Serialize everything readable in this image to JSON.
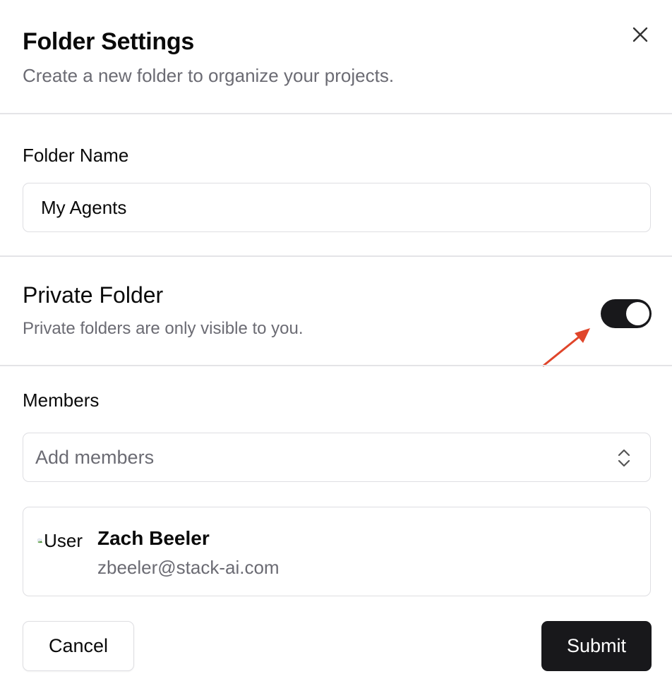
{
  "dialog": {
    "title": "Folder Settings",
    "subtitle": "Create a new folder to organize your projects.",
    "close_icon": "close-icon"
  },
  "folder_name": {
    "label": "Folder Name",
    "value": "My Agents"
  },
  "private_folder": {
    "title": "Private Folder",
    "description": "Private folders are only visible to you.",
    "enabled": true
  },
  "members": {
    "label": "Members",
    "select_placeholder": "Add members",
    "list": [
      {
        "avatar_alt": "User",
        "name": "Zach Beeler",
        "email": "zbeeler@stack-ai.com"
      }
    ]
  },
  "actions": {
    "cancel_label": "Cancel",
    "submit_label": "Submit"
  },
  "colors": {
    "primary": "#18181b",
    "muted_text": "#6b6b73",
    "border": "#dedee2",
    "annotation_arrow": "#e0452a"
  }
}
